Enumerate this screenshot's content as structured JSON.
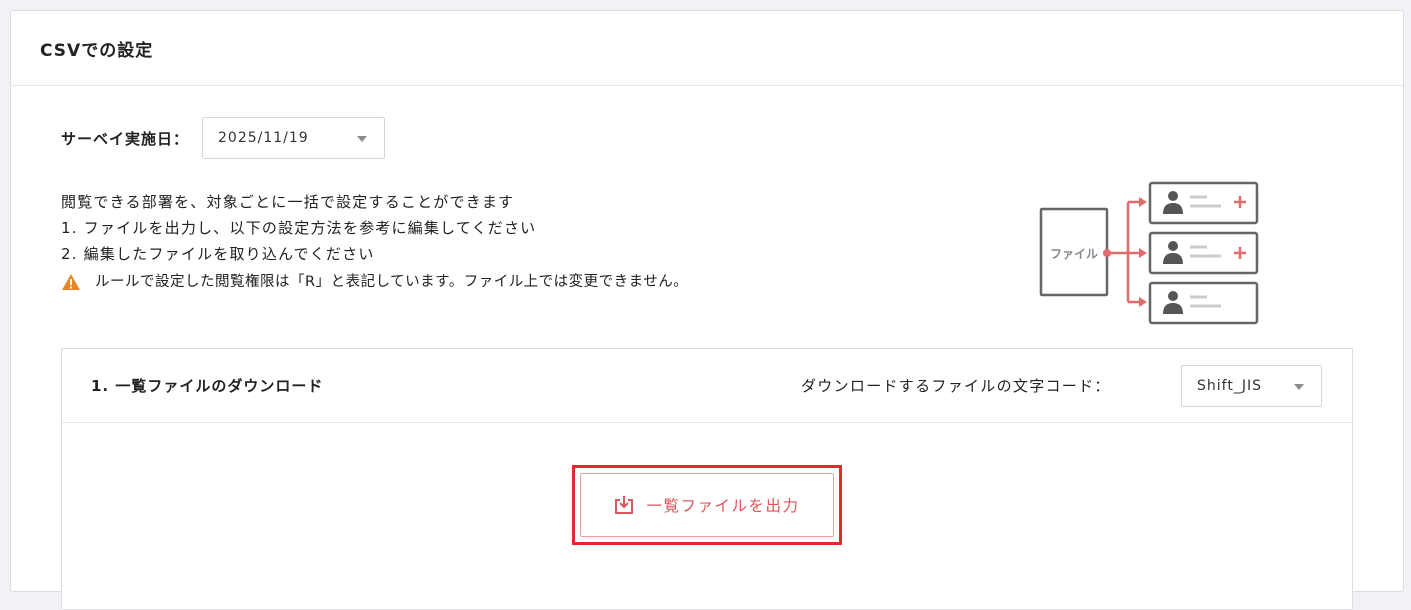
{
  "card": {
    "title": "CSVでの設定"
  },
  "survey": {
    "label": "サーベイ実施日：",
    "date": "2025/11/19"
  },
  "description": {
    "line1": "閲覧できる部署を、対象ごとに一括で設定することができます",
    "line2": "1. ファイルを出力し、以下の設定方法を参考に編集してください",
    "line3": "2. 編集したファイルを取り込んでください",
    "warning": "ルールで設定した閲覧権限は「R」と表記しています。ファイル上では変更できません。"
  },
  "illustration": {
    "file_label": "ファイル"
  },
  "download_section": {
    "title": "1. 一覧ファイルのダウンロード",
    "encoding_label": "ダウンロードするファイルの文字コード：",
    "encoding_value": "Shift_JIS",
    "export_button": "一覧ファイルを出力"
  },
  "colors": {
    "accent": "#d9595d",
    "highlight": "#e22a2e",
    "warning": "#e8862c"
  }
}
